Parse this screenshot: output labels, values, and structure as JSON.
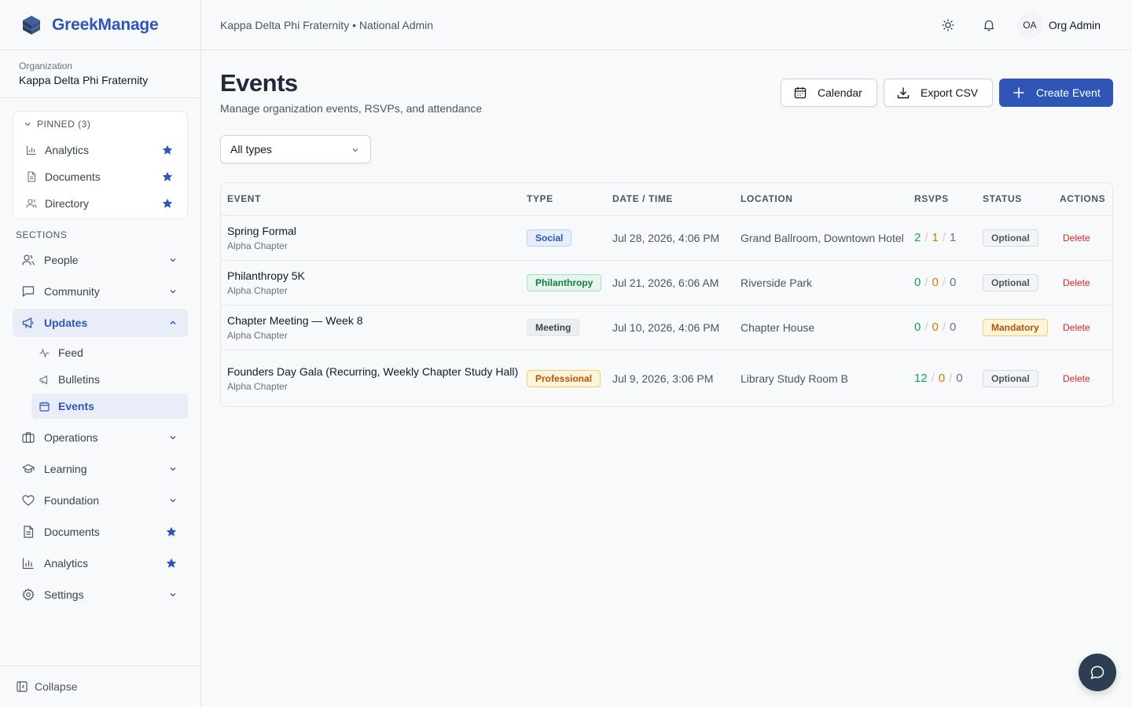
{
  "app": {
    "name": "GreekManage"
  },
  "org": {
    "label": "Organization",
    "name": "Kappa Delta Phi Fraternity"
  },
  "pinned": {
    "title": "PINNED (3)",
    "items": [
      {
        "label": "Analytics",
        "icon": "bar-chart-icon"
      },
      {
        "label": "Documents",
        "icon": "document-icon"
      },
      {
        "label": "Directory",
        "icon": "users-icon"
      }
    ]
  },
  "sections": {
    "title": "SECTIONS",
    "items": [
      {
        "label": "People"
      },
      {
        "label": "Community"
      },
      {
        "label": "Updates"
      },
      {
        "label": "Operations"
      },
      {
        "label": "Learning"
      },
      {
        "label": "Foundation"
      },
      {
        "label": "Documents"
      },
      {
        "label": "Analytics"
      },
      {
        "label": "Settings"
      }
    ],
    "updates_sub": [
      {
        "label": "Feed"
      },
      {
        "label": "Bulletins"
      },
      {
        "label": "Events"
      }
    ]
  },
  "collapse_label": "Collapse",
  "header": {
    "breadcrumb": "Kappa Delta Phi Fraternity • National Admin",
    "avatar_initials": "OA",
    "user_name": "Org Admin"
  },
  "page": {
    "title": "Events",
    "subtitle": "Manage organization events, RSVPs, and attendance",
    "calendar_label": "Calendar",
    "export_label": "Export CSV",
    "create_label": "Create Event",
    "filter_value": "All types"
  },
  "table": {
    "headers": [
      "EVENT",
      "TYPE",
      "DATE / TIME",
      "LOCATION",
      "RSVPS",
      "STATUS",
      "ACTIONS"
    ],
    "rows": [
      {
        "name": "Spring Formal",
        "chapter": "Alpha Chapter",
        "type": "Social",
        "date": "Jul 28, 2026, 4:06 PM",
        "location": "Grand Ballroom, Downtown Hotel",
        "yes": "2",
        "maybe": "1",
        "no": "1",
        "status": "Optional",
        "action": "Delete"
      },
      {
        "name": "Philanthropy 5K",
        "chapter": "Alpha Chapter",
        "type": "Philanthropy",
        "date": "Jul 21, 2026, 6:06 AM",
        "location": "Riverside Park",
        "yes": "0",
        "maybe": "0",
        "no": "0",
        "status": "Optional",
        "action": "Delete"
      },
      {
        "name": "Chapter Meeting — Week 8",
        "chapter": "Alpha Chapter",
        "type": "Meeting",
        "date": "Jul 10, 2026, 4:06 PM",
        "location": "Chapter House",
        "yes": "0",
        "maybe": "0",
        "no": "0",
        "status": "Mandatory",
        "action": "Delete"
      },
      {
        "name": "Founders Day Gala (Recurring, Weekly Chapter Study Hall)",
        "chapter": "Alpha Chapter",
        "type": "Professional",
        "date": "Jul 9, 2026, 3:06 PM",
        "location": "Library Study Room B",
        "yes": "12",
        "maybe": "0",
        "no": "0",
        "status": "Optional",
        "action": "Delete"
      }
    ],
    "separator": "/"
  },
  "colors": {
    "brand": "#2f56b7",
    "rsvp_yes": "#16a34a",
    "rsvp_maybe": "#d97706",
    "delete": "#dc2626"
  }
}
